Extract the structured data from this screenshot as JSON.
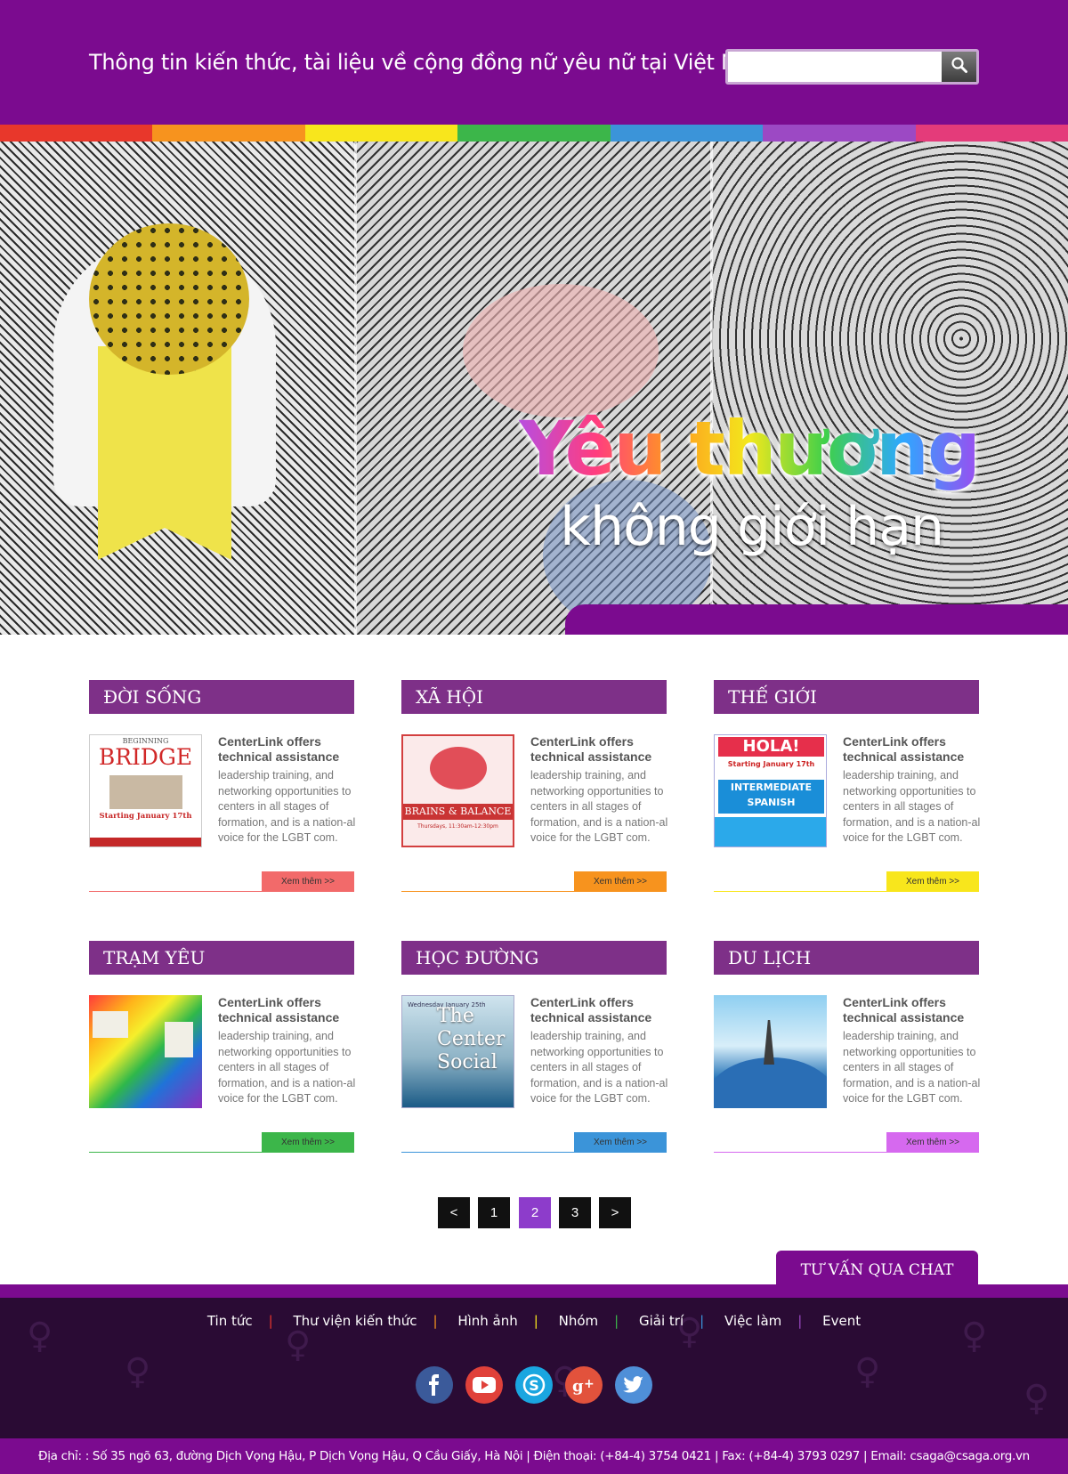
{
  "header": {
    "tagline": "Thông tin kiến thức, tài liệu về cộng đồng nữ yêu nữ tại Việt Nam",
    "search_placeholder": ""
  },
  "stripe_colors": [
    "#e8372b",
    "#f7931e",
    "#f8e61c",
    "#3cb64a",
    "#3b94d9",
    "#9c49c4",
    "#e43b7a"
  ],
  "hero": {
    "title": "Yêu thương",
    "subtitle": "không giới hạn"
  },
  "cards": [
    {
      "heading": "ĐỜI SỐNG",
      "title": "CenterLink offers technical assistance",
      "desc": "leadership training, and networking opportunities to centers in all stages of formation, and is a nation-al voice for the LGBT com.",
      "more": "Xem thêm >>",
      "accent": "#f26a6a",
      "img": {
        "t1": "BEGINNING",
        "t2": "BRIDGE",
        "t3": "Starting January 17th"
      }
    },
    {
      "heading": "XÃ HỘI",
      "title": "CenterLink offers technical assistance",
      "desc": "leadership training, and networking opportunities to centers in all stages of formation, and is a nation-al voice for the LGBT com.",
      "more": "Xem thêm >>",
      "accent": "#f7931e",
      "img": {
        "banner": "BRAINS & BALANCE",
        "t": "Thursdays, 11:30am-12:30pm"
      }
    },
    {
      "heading": "THẾ GIỚI",
      "title": "CenterLink offers technical assistance",
      "desc": "leadership training, and networking opportunities to centers in all stages of formation, and is a nation-al voice for the LGBT com.",
      "more": "Xem thêm >>",
      "accent": "#f8e61c",
      "img": {
        "top": "HOLA!",
        "date": "Starting January 17th",
        "s1": "INTERMEDIATE",
        "s2": "SPANISH"
      }
    },
    {
      "heading": "TRẠM YÊU",
      "title": "CenterLink offers technical assistance",
      "desc": "leadership training, and networking opportunities to centers in all stages of formation, and is a nation-al voice for the LGBT com.",
      "more": "Xem thêm >>",
      "accent": "#3cb64a",
      "img": {}
    },
    {
      "heading": "HỌC ĐƯỜNG",
      "title": "CenterLink offers technical assistance",
      "desc": "leadership training, and networking opportunities to centers in all stages of formation, and is a nation-al voice for the LGBT com.",
      "more": "Xem thêm >>",
      "accent": "#3b94d9",
      "img": {
        "date": "Wednesday January 25th",
        "big": "The Center Social"
      }
    },
    {
      "heading": "DU LỊCH",
      "title": "CenterLink offers technical assistance",
      "desc": "leadership training, and networking opportunities to centers in all stages of formation, and is a nation-al voice for the LGBT com.",
      "more": "Xem thêm >>",
      "accent": "#d669ef",
      "img": {}
    }
  ],
  "pagination": {
    "prev": "<",
    "pages": [
      "1",
      "2",
      "3"
    ],
    "active": "2",
    "next": ">"
  },
  "chat": {
    "label": "TƯ VẤN QUA CHAT"
  },
  "footer": {
    "nav": [
      {
        "label": "Tin tức",
        "sep_color": "#e8372b"
      },
      {
        "label": "Thư viện kiến thức",
        "sep_color": "#f7931e"
      },
      {
        "label": "Hình ảnh",
        "sep_color": "#f8e61c"
      },
      {
        "label": "Nhóm",
        "sep_color": "#3cb64a"
      },
      {
        "label": "Giải trí",
        "sep_color": "#3b94d9"
      },
      {
        "label": "Việc làm",
        "sep_color": "#9c49c4"
      },
      {
        "label": "Event",
        "sep_color": ""
      }
    ],
    "social": [
      {
        "name": "facebook-icon",
        "color": "#3b5a9a"
      },
      {
        "name": "youtube-icon",
        "color": "#e0413a"
      },
      {
        "name": "skype-icon",
        "color": "#1aa6e0"
      },
      {
        "name": "google-plus-icon",
        "color": "#e2523c"
      },
      {
        "name": "twitter-icon",
        "color": "#4f8fd8"
      }
    ],
    "address": "Địa chỉ: : Số 35 ngõ 63, đường Dịch Vọng Hậu, P Dịch Vọng Hậu, Q Cầu Giấy, Hà Nội  |  Điện thoại: (+84-4) 3754 0421  |  Fax: (+84-4) 3793 0297  |  Email: csaga@csaga.org.vn"
  }
}
